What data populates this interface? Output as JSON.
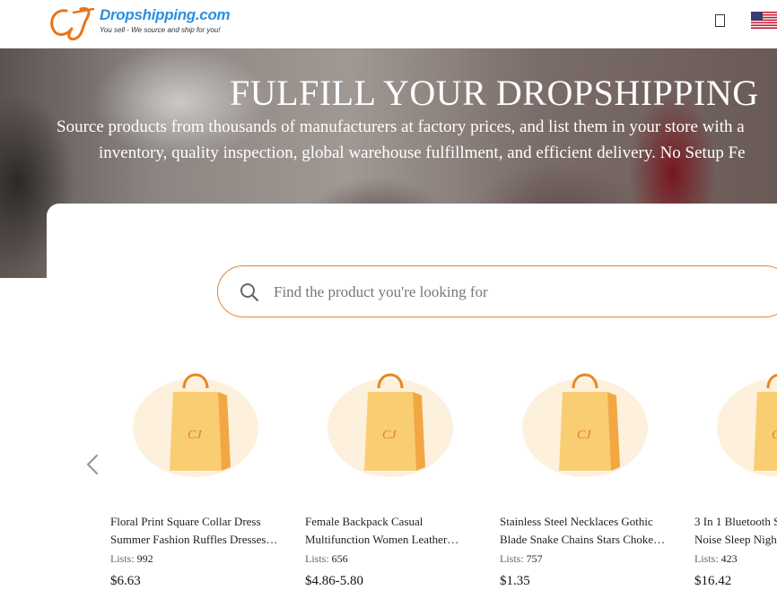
{
  "header": {
    "logo_text": "Dropshipping.com",
    "logo_tagline": "You sell - We source and ship for you!",
    "brand_color": "#2a8fe0",
    "accent_color": "#e8751a",
    "icons": [
      "cart-icon",
      "us-flag-icon"
    ]
  },
  "hero": {
    "title": "FULFILL YOUR DROPSHIPPING",
    "subtitle_line1": "Source products from thousands of manufacturers at factory prices, and list them in your store with a",
    "subtitle_line2": "inventory, quality inspection, global warehouse fulfillment, and efficient delivery. No Setup Fe"
  },
  "search": {
    "placeholder": "Find the product you're looking for",
    "value": "",
    "icon": "search-icon"
  },
  "carousel": {
    "prev_icon": "chevron-left-icon",
    "lists_label": "Lists:",
    "products": [
      {
        "name_line1": "Floral Print Square Collar Dress",
        "name_line2": "Summer Fashion Ruffles Dresses…",
        "lists": "992",
        "price": "$6.63"
      },
      {
        "name_line1": "Female Backpack Casual",
        "name_line2": "Multifunction Women Leather…",
        "lists": "656",
        "price": "$4.86-5.80"
      },
      {
        "name_line1": "Stainless Steel Necklaces Gothic",
        "name_line2": "Blade Snake Chains Stars Choke…",
        "lists": "757",
        "price": "$1.35"
      },
      {
        "name_line1": "3 In 1 Bluetooth S",
        "name_line2": "Noise Sleep Nigh",
        "lists": "423",
        "price": "$16.42"
      }
    ]
  }
}
